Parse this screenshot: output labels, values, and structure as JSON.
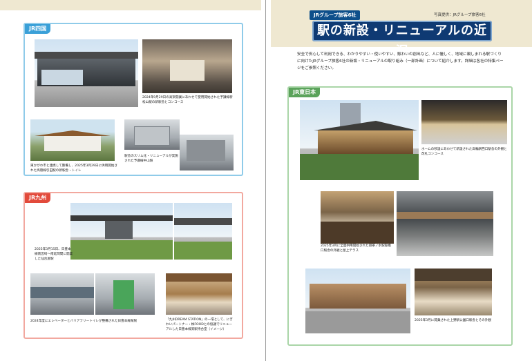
{
  "left_page": {
    "jr_shikoku": {
      "tag": "JR四国",
      "captions": {
        "cap1": "2024年9月29日の高架開業にあわせて使用開始された予讃線新松山駅の新駅舎とコンコース",
        "cap2": "東かがわ市と連携して整備し、2025年3月29日に供用開始された高徳線引田駅の新駅舎・トイレ",
        "cap3": "駅舎のスリム化・リニューアルが実施された予讃線中山駅"
      }
    },
    "jr_kyushu": {
      "tag": "JR九州",
      "captions": {
        "cap1": "2025年3月15日、日豊本線南宮崎～南延岡間に開業した仙台屋駅",
        "cap2": "2024年度にエレベーターとバリアフリートイレが整備された日豊本線某駅",
        "cap3": "「九州DREAM STATION」の一環として、にぎわいパートナー・株FOODとの協議でリニューアルした日豊本線某駅待合室（イメージ）"
      }
    }
  },
  "right_page": {
    "subtitle": "JRグループ旅客6社",
    "credit": "写真提供：JRグループ旅客6社",
    "title": "駅の新設・リニューアルの近況",
    "intro": "安全で安心して利用できる、わかりやすい・使いやすい、賑わいの創出など、人に優しく、地域に親しまれる駅づくりに向けたJRグループ旅客6社の新設・リニューアルの取り組み（一部計画）について紹介します。詳細は各社の特集ページをご参照ください。",
    "jr_east": {
      "tag": "JR東日本",
      "captions": {
        "cap1": "ホームの移設にあわせて新設された高輪駅西口駅舎の外観と改札コンコース",
        "cap2": "2025年3月に全面供用開始された御茶ノ水駅聖橋口駅舎の外観と屋上テラス",
        "cap3": "2025年3月に開業された上野駅公園口駅舎とその外観"
      }
    }
  },
  "colors": {
    "shikoku": "#3aa0d8",
    "kyushu": "#e24a3b",
    "east": "#5ba35b",
    "title_bg": "#0f3a73"
  }
}
